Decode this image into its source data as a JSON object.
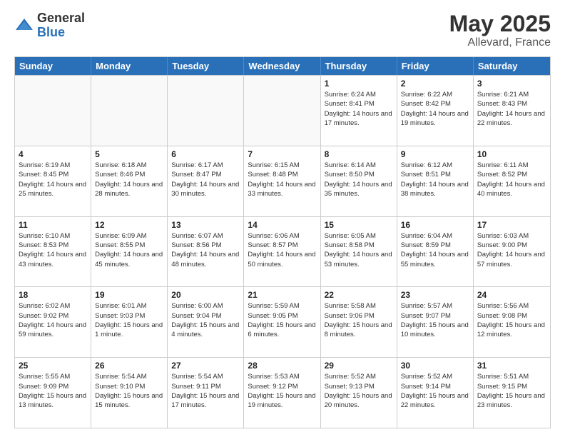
{
  "logo": {
    "general": "General",
    "blue": "Blue"
  },
  "title": {
    "month": "May 2025",
    "location": "Allevard, France"
  },
  "header_days": [
    "Sunday",
    "Monday",
    "Tuesday",
    "Wednesday",
    "Thursday",
    "Friday",
    "Saturday"
  ],
  "rows": [
    [
      {
        "day": "",
        "sunrise": "",
        "sunset": "",
        "daylight": ""
      },
      {
        "day": "",
        "sunrise": "",
        "sunset": "",
        "daylight": ""
      },
      {
        "day": "",
        "sunrise": "",
        "sunset": "",
        "daylight": ""
      },
      {
        "day": "",
        "sunrise": "",
        "sunset": "",
        "daylight": ""
      },
      {
        "day": "1",
        "sunrise": "Sunrise: 6:24 AM",
        "sunset": "Sunset: 8:41 PM",
        "daylight": "Daylight: 14 hours and 17 minutes."
      },
      {
        "day": "2",
        "sunrise": "Sunrise: 6:22 AM",
        "sunset": "Sunset: 8:42 PM",
        "daylight": "Daylight: 14 hours and 19 minutes."
      },
      {
        "day": "3",
        "sunrise": "Sunrise: 6:21 AM",
        "sunset": "Sunset: 8:43 PM",
        "daylight": "Daylight: 14 hours and 22 minutes."
      }
    ],
    [
      {
        "day": "4",
        "sunrise": "Sunrise: 6:19 AM",
        "sunset": "Sunset: 8:45 PM",
        "daylight": "Daylight: 14 hours and 25 minutes."
      },
      {
        "day": "5",
        "sunrise": "Sunrise: 6:18 AM",
        "sunset": "Sunset: 8:46 PM",
        "daylight": "Daylight: 14 hours and 28 minutes."
      },
      {
        "day": "6",
        "sunrise": "Sunrise: 6:17 AM",
        "sunset": "Sunset: 8:47 PM",
        "daylight": "Daylight: 14 hours and 30 minutes."
      },
      {
        "day": "7",
        "sunrise": "Sunrise: 6:15 AM",
        "sunset": "Sunset: 8:48 PM",
        "daylight": "Daylight: 14 hours and 33 minutes."
      },
      {
        "day": "8",
        "sunrise": "Sunrise: 6:14 AM",
        "sunset": "Sunset: 8:50 PM",
        "daylight": "Daylight: 14 hours and 35 minutes."
      },
      {
        "day": "9",
        "sunrise": "Sunrise: 6:12 AM",
        "sunset": "Sunset: 8:51 PM",
        "daylight": "Daylight: 14 hours and 38 minutes."
      },
      {
        "day": "10",
        "sunrise": "Sunrise: 6:11 AM",
        "sunset": "Sunset: 8:52 PM",
        "daylight": "Daylight: 14 hours and 40 minutes."
      }
    ],
    [
      {
        "day": "11",
        "sunrise": "Sunrise: 6:10 AM",
        "sunset": "Sunset: 8:53 PM",
        "daylight": "Daylight: 14 hours and 43 minutes."
      },
      {
        "day": "12",
        "sunrise": "Sunrise: 6:09 AM",
        "sunset": "Sunset: 8:55 PM",
        "daylight": "Daylight: 14 hours and 45 minutes."
      },
      {
        "day": "13",
        "sunrise": "Sunrise: 6:07 AM",
        "sunset": "Sunset: 8:56 PM",
        "daylight": "Daylight: 14 hours and 48 minutes."
      },
      {
        "day": "14",
        "sunrise": "Sunrise: 6:06 AM",
        "sunset": "Sunset: 8:57 PM",
        "daylight": "Daylight: 14 hours and 50 minutes."
      },
      {
        "day": "15",
        "sunrise": "Sunrise: 6:05 AM",
        "sunset": "Sunset: 8:58 PM",
        "daylight": "Daylight: 14 hours and 53 minutes."
      },
      {
        "day": "16",
        "sunrise": "Sunrise: 6:04 AM",
        "sunset": "Sunset: 8:59 PM",
        "daylight": "Daylight: 14 hours and 55 minutes."
      },
      {
        "day": "17",
        "sunrise": "Sunrise: 6:03 AM",
        "sunset": "Sunset: 9:00 PM",
        "daylight": "Daylight: 14 hours and 57 minutes."
      }
    ],
    [
      {
        "day": "18",
        "sunrise": "Sunrise: 6:02 AM",
        "sunset": "Sunset: 9:02 PM",
        "daylight": "Daylight: 14 hours and 59 minutes."
      },
      {
        "day": "19",
        "sunrise": "Sunrise: 6:01 AM",
        "sunset": "Sunset: 9:03 PM",
        "daylight": "Daylight: 15 hours and 1 minute."
      },
      {
        "day": "20",
        "sunrise": "Sunrise: 6:00 AM",
        "sunset": "Sunset: 9:04 PM",
        "daylight": "Daylight: 15 hours and 4 minutes."
      },
      {
        "day": "21",
        "sunrise": "Sunrise: 5:59 AM",
        "sunset": "Sunset: 9:05 PM",
        "daylight": "Daylight: 15 hours and 6 minutes."
      },
      {
        "day": "22",
        "sunrise": "Sunrise: 5:58 AM",
        "sunset": "Sunset: 9:06 PM",
        "daylight": "Daylight: 15 hours and 8 minutes."
      },
      {
        "day": "23",
        "sunrise": "Sunrise: 5:57 AM",
        "sunset": "Sunset: 9:07 PM",
        "daylight": "Daylight: 15 hours and 10 minutes."
      },
      {
        "day": "24",
        "sunrise": "Sunrise: 5:56 AM",
        "sunset": "Sunset: 9:08 PM",
        "daylight": "Daylight: 15 hours and 12 minutes."
      }
    ],
    [
      {
        "day": "25",
        "sunrise": "Sunrise: 5:55 AM",
        "sunset": "Sunset: 9:09 PM",
        "daylight": "Daylight: 15 hours and 13 minutes."
      },
      {
        "day": "26",
        "sunrise": "Sunrise: 5:54 AM",
        "sunset": "Sunset: 9:10 PM",
        "daylight": "Daylight: 15 hours and 15 minutes."
      },
      {
        "day": "27",
        "sunrise": "Sunrise: 5:54 AM",
        "sunset": "Sunset: 9:11 PM",
        "daylight": "Daylight: 15 hours and 17 minutes."
      },
      {
        "day": "28",
        "sunrise": "Sunrise: 5:53 AM",
        "sunset": "Sunset: 9:12 PM",
        "daylight": "Daylight: 15 hours and 19 minutes."
      },
      {
        "day": "29",
        "sunrise": "Sunrise: 5:52 AM",
        "sunset": "Sunset: 9:13 PM",
        "daylight": "Daylight: 15 hours and 20 minutes."
      },
      {
        "day": "30",
        "sunrise": "Sunrise: 5:52 AM",
        "sunset": "Sunset: 9:14 PM",
        "daylight": "Daylight: 15 hours and 22 minutes."
      },
      {
        "day": "31",
        "sunrise": "Sunrise: 5:51 AM",
        "sunset": "Sunset: 9:15 PM",
        "daylight": "Daylight: 15 hours and 23 minutes."
      }
    ]
  ]
}
